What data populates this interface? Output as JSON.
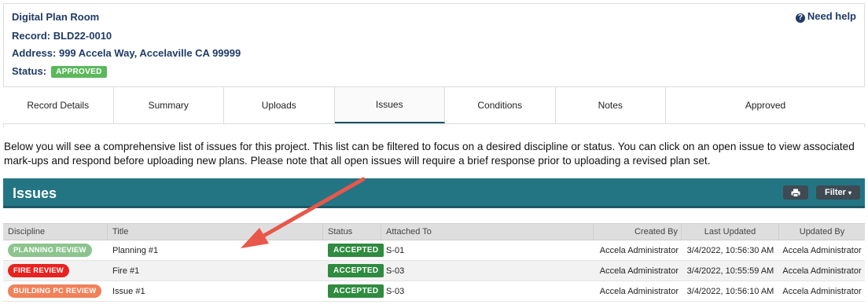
{
  "header": {
    "title": "Digital Plan Room",
    "record": "Record: BLD22-0010",
    "address": "Address: 999 Accela Way, Accelaville CA 99999",
    "status_label": "Status:",
    "status_badge": "APPROVED",
    "status_color": "#5cb85c",
    "help_icon": "question-circle-icon",
    "help_label": "Need help"
  },
  "tabs": [
    {
      "label": "Record Details"
    },
    {
      "label": "Summary"
    },
    {
      "label": "Uploads"
    },
    {
      "label": "Issues",
      "active": true
    },
    {
      "label": "Conditions"
    },
    {
      "label": "Notes"
    },
    {
      "label": "Approved"
    }
  ],
  "intro": "Below you will see a comprehensive list of issues for this project. This list can be filtered to focus on a desired discipline or status. You can click on an open issue to view associated mark-ups and respond before uploading new plans. Please note that all open issues will require a brief response prior to uploading a revised plan set.",
  "issues_panel": {
    "title": "Issues",
    "bar_color": "#237584",
    "print_icon": "printer-icon",
    "filter_label": "Filter",
    "filter_icon": "caret-down-icon"
  },
  "table": {
    "columns": [
      "Discipline",
      "Title",
      "Status",
      "Attached To",
      "Created By",
      "Last Updated",
      "Updated By"
    ],
    "rows": [
      {
        "discipline": "PLANNING REVIEW",
        "discipline_color": "#8cc48e",
        "title": "Planning #1",
        "status": "ACCEPTED",
        "attached_to": "S-01",
        "created_by": "Accela Administrator",
        "last_updated": "3/4/2022, 10:56:30 AM",
        "updated_by": "Accela Administrator"
      },
      {
        "discipline": "FIRE REVIEW",
        "discipline_color": "#e8221f",
        "title": "Fire #1",
        "status": "ACCEPTED",
        "attached_to": "S-03",
        "created_by": "Accela Administrator",
        "last_updated": "3/4/2022, 10:55:59 AM",
        "updated_by": "Accela Administrator"
      },
      {
        "discipline": "BUILDING PC REVIEW",
        "discipline_color": "#f08159",
        "title": "Issue #1",
        "status": "ACCEPTED",
        "attached_to": "S-03",
        "created_by": "Accela Administrator",
        "last_updated": "3/4/2022, 10:56:10 AM",
        "updated_by": "Accela Administrator"
      }
    ],
    "status_color": "#2e8b3f"
  },
  "annotation": {
    "arrow_color": "#e8574a"
  }
}
